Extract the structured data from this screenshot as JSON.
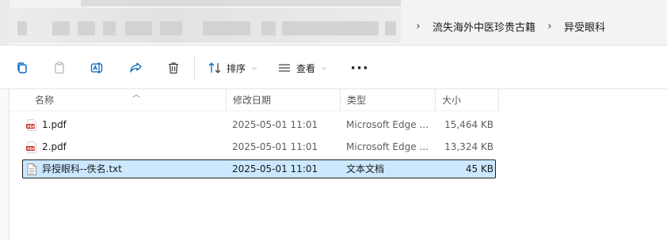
{
  "breadcrumb": {
    "items": [
      "流失海外中医珍贵古籍",
      "异受眼科"
    ],
    "separator": "›"
  },
  "toolbar": {
    "sort_label": "排序",
    "view_label": "查看",
    "more_label": "···"
  },
  "columns": {
    "name": "名称",
    "modified": "修改日期",
    "type": "类型",
    "size": "大小"
  },
  "files": [
    {
      "icon": "pdf-file-icon",
      "name": "1.pdf",
      "modified": "2025-05-01 11:01",
      "type": "Microsoft Edge ...",
      "size": "15,464 KB",
      "selected": false
    },
    {
      "icon": "pdf-file-icon",
      "name": "2.pdf",
      "modified": "2025-05-01 11:01",
      "type": "Microsoft Edge ...",
      "size": "13,324 KB",
      "selected": false
    },
    {
      "icon": "text-file-icon",
      "name": "异授眼科--佚名.txt",
      "modified": "2025-05-01 11:01",
      "type": "文本文档",
      "size": "45 KB",
      "selected": true
    }
  ],
  "colors": {
    "selection_bg": "#cce8ff",
    "pdf_red": "#d0312d",
    "accent_blue": "#0067c0"
  }
}
